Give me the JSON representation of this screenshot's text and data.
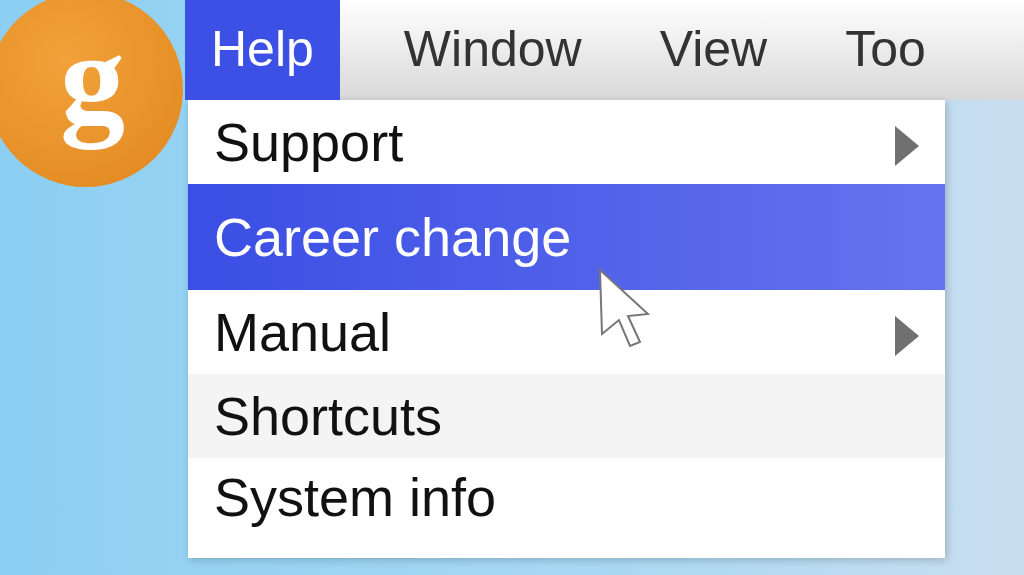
{
  "logo": {
    "letter": "g"
  },
  "menubar": [
    {
      "label": "Help",
      "selected": true
    },
    {
      "label": "Window",
      "selected": false
    },
    {
      "label": "View",
      "selected": false
    },
    {
      "label": "Too",
      "selected": false
    }
  ],
  "menu": [
    {
      "label": "Support",
      "selected": false,
      "submenu": true
    },
    {
      "label": "Career change",
      "selected": true,
      "submenu": false
    },
    {
      "label": "Manual",
      "selected": false,
      "submenu": true
    },
    {
      "label": "Shortcuts",
      "selected": false,
      "submenu": false
    },
    {
      "label": "System info",
      "selected": false,
      "submenu": false
    }
  ]
}
